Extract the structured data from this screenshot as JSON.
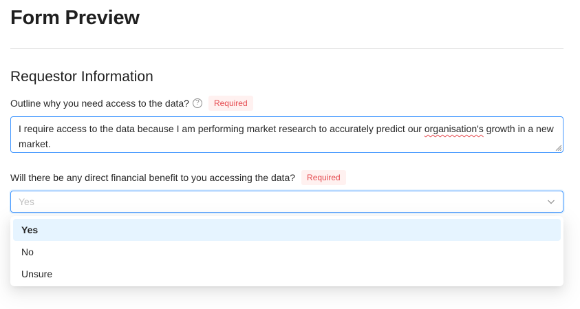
{
  "page": {
    "title": "Form Preview"
  },
  "section": {
    "title": "Requestor Information"
  },
  "fields": [
    {
      "label": "Outline why you need access to the data?",
      "help_icon": "question-circle-icon",
      "required_label": "Required",
      "value_part1": "I require access to the data because I am performing market research to accurately predict our ",
      "value_misspelled": "organisation's",
      "value_part2": " growth in a new market."
    },
    {
      "label": "Will there be any direct financial benefit to you accessing the data?",
      "required_label": "Required",
      "placeholder": "Yes",
      "chevron_icon": "chevron-down-icon",
      "options": [
        "Yes",
        "No",
        "Unsure"
      ],
      "highlighted_option": "Yes"
    }
  ],
  "colors": {
    "accent": "#4096ff",
    "required": "#e5484d",
    "required_bg": "#fff1f0",
    "option_highlight": "#e6f4ff"
  }
}
